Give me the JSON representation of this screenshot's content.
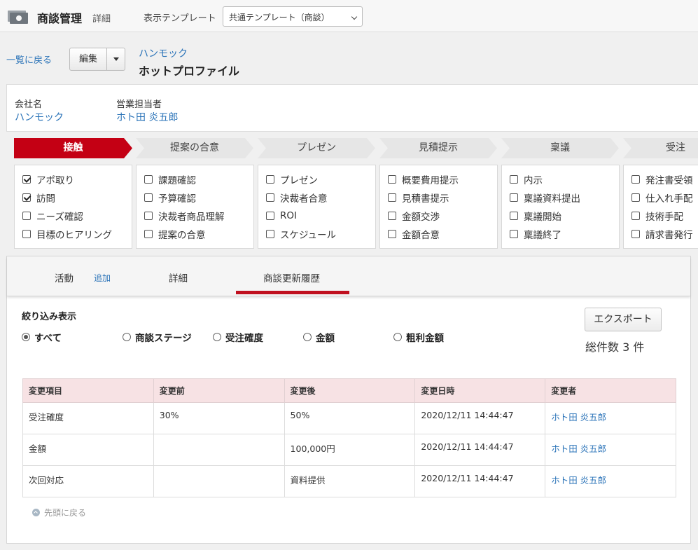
{
  "header": {
    "app_title": "商談管理",
    "app_sub": "詳細",
    "template_label": "表示テンプレート",
    "template_value": "共通テンプレート（商談）"
  },
  "subheader": {
    "back_link": "一覧に戻る",
    "edit_label": "編集",
    "company": "ハンモック",
    "deal_name": "ホットプロファイル"
  },
  "info": {
    "company_label": "会社名",
    "company_value": "ハンモック",
    "rep_label": "営業担当者",
    "rep_value": "ホト田 炎五郎"
  },
  "stages": [
    "接触",
    "提案の合意",
    "プレゼン",
    "見積提示",
    "稟議",
    "受注"
  ],
  "checklists": [
    {
      "items": [
        {
          "label": "アポ取り",
          "checked": true
        },
        {
          "label": "訪問",
          "checked": true
        },
        {
          "label": "ニーズ確認",
          "checked": false
        },
        {
          "label": "目標のヒアリング",
          "checked": false
        }
      ]
    },
    {
      "items": [
        {
          "label": "課題確認",
          "checked": false
        },
        {
          "label": "予算確認",
          "checked": false
        },
        {
          "label": "決裁者商品理解",
          "checked": false
        },
        {
          "label": "提案の合意",
          "checked": false
        }
      ]
    },
    {
      "items": [
        {
          "label": "プレゼン",
          "checked": false
        },
        {
          "label": "決裁者合意",
          "checked": false
        },
        {
          "label": "ROI",
          "checked": false
        },
        {
          "label": "スケジュール",
          "checked": false
        }
      ]
    },
    {
      "items": [
        {
          "label": "概要費用提示",
          "checked": false
        },
        {
          "label": "見積書提示",
          "checked": false
        },
        {
          "label": "金額交渉",
          "checked": false
        },
        {
          "label": "金額合意",
          "checked": false
        }
      ]
    },
    {
      "items": [
        {
          "label": "内示",
          "checked": false
        },
        {
          "label": "稟議資料提出",
          "checked": false
        },
        {
          "label": "稟議開始",
          "checked": false
        },
        {
          "label": "稟議終了",
          "checked": false
        }
      ]
    },
    {
      "items": [
        {
          "label": "発注書受領",
          "checked": false
        },
        {
          "label": "仕入れ手配",
          "checked": false
        },
        {
          "label": "技術手配",
          "checked": false
        },
        {
          "label": "請求書発行",
          "checked": false
        }
      ]
    }
  ],
  "tabs": {
    "activity": "活動",
    "add": "追加",
    "detail": "詳細",
    "history": "商談更新履歴"
  },
  "filter": {
    "title": "絞り込み表示",
    "options": [
      "すべて",
      "商談ステージ",
      "受注確度",
      "金額",
      "粗利金額"
    ],
    "selected": "すべて"
  },
  "export_label": "エクスポート",
  "total_count": "総件数 3 件",
  "table": {
    "headers": [
      "変更項目",
      "変更前",
      "変更後",
      "変更日時",
      "変更者"
    ],
    "rows": [
      [
        "受注確度",
        "30%",
        "50%",
        "2020/12/11 14:44:47",
        "ホト田 炎五郎"
      ],
      [
        "金額",
        "",
        "100,000円",
        "2020/12/11 14:44:47",
        "ホト田 炎五郎"
      ],
      [
        "次回対応",
        "",
        "資料提供",
        "2020/12/11 14:44:47",
        "ホト田 炎五郎"
      ]
    ]
  },
  "back_to_top": "先頭に戻る",
  "colors": {
    "accent": "#c40014",
    "link": "#2a73b8",
    "table_header": "#f7e2e4"
  }
}
